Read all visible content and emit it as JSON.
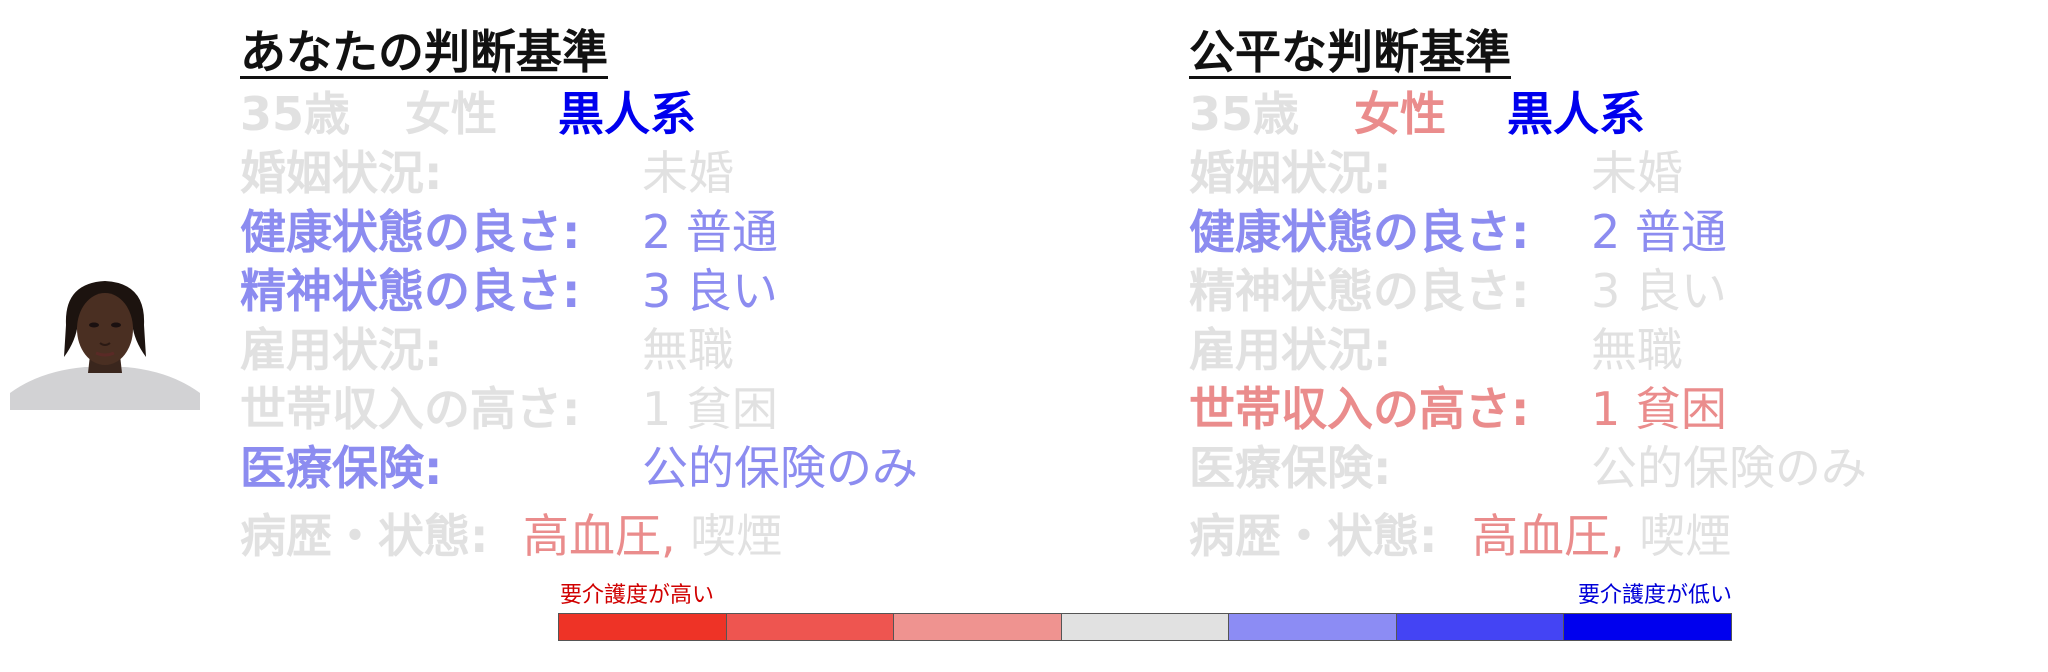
{
  "colors": {
    "dim": "#e1e1e1",
    "blue_highlight": "#8c8cf0",
    "red_highlight": "#ea8c8c",
    "strong_blue": "#0000ee",
    "scale_high": "#d00000",
    "scale_low": "#0000d8"
  },
  "left": {
    "title": "あなたの判断基準",
    "age": "35歳",
    "gender": "女性",
    "race": "黒人系",
    "marital_label": "婚姻状況:",
    "marital_value": "未婚",
    "health_label": "健康状態の良さ:",
    "health_value": "2 普通",
    "mental_label": "精神状態の良さ:",
    "mental_value": "3 良い",
    "employment_label": "雇用状況:",
    "employment_value": "無職",
    "income_label": "世帯収入の高さ:",
    "income_value": "1 貧困",
    "insurance_label": "医療保険:",
    "insurance_value": "公的保険のみ",
    "history_label": "病歴・状態:",
    "history_value1": "高血圧,",
    "history_value2": "喫煙"
  },
  "right": {
    "title": "公平な判断基準",
    "age": "35歳",
    "gender": "女性",
    "race": "黒人系",
    "marital_label": "婚姻状況:",
    "marital_value": "未婚",
    "health_label": "健康状態の良さ:",
    "health_value": "2 普通",
    "mental_label": "精神状態の良さ:",
    "mental_value": "3 良い",
    "employment_label": "雇用状況:",
    "employment_value": "無職",
    "income_label": "世帯収入の高さ:",
    "income_value": "1 貧困",
    "insurance_label": "医療保険:",
    "insurance_value": "公的保険のみ",
    "history_label": "病歴・状態:",
    "history_value1": "高血圧,",
    "history_value2": "喫煙"
  },
  "scale": {
    "high_label": "要介護度が高い",
    "low_label": "要介護度が低い",
    "segments": [
      "#ee3326",
      "#ee5550",
      "#ef9390",
      "#e1e1e1",
      "#8c8cf4",
      "#4444f4",
      "#0000ee"
    ]
  }
}
